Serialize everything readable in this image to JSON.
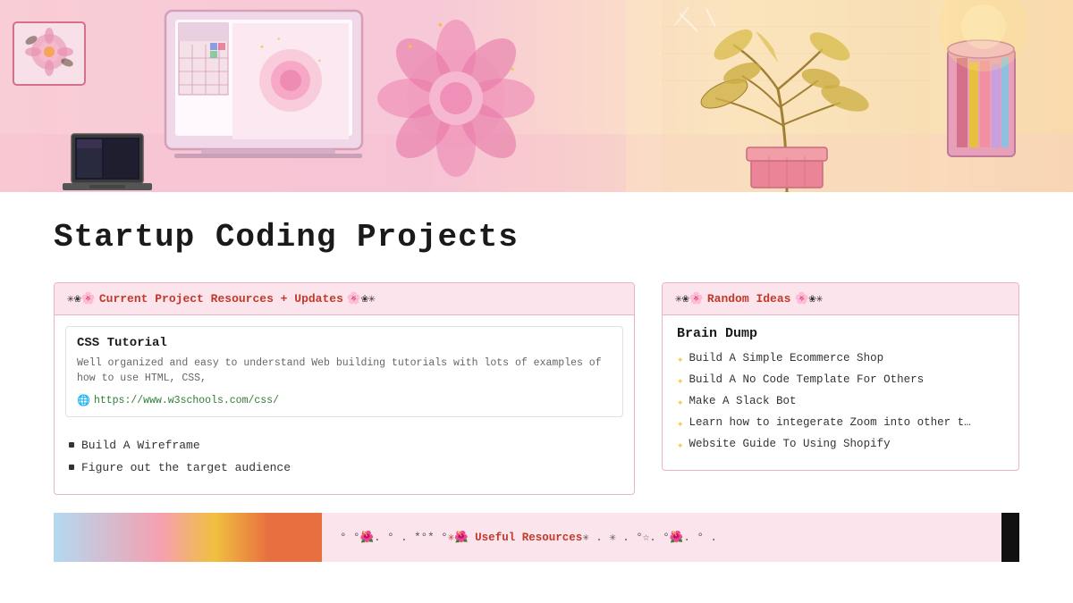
{
  "page": {
    "title": "Startup Coding Projects"
  },
  "hero": {
    "alt": "Illustrated desk scene with laptop, flowers, and plants"
  },
  "left_section": {
    "header": {
      "prefix": "✳❀🌸 ",
      "title": "Current Project Resources + Updates",
      "suffix": " 🌸❀✳"
    },
    "link_card": {
      "title": "CSS Tutorial",
      "description": "Well organized and easy to understand Web building tutorials with lots of examples of how to use HTML, CSS,",
      "url": "https://www.w3schools.com/css/"
    },
    "bullets": [
      "Build A Wireframe",
      "Figure out the target audience"
    ]
  },
  "right_section": {
    "header": {
      "prefix": "✳❀🌸 ",
      "title": "Random Ideas",
      "suffix": " 🌸❀✳"
    },
    "brain_dump_title": "Brain Dump",
    "ideas": [
      "Build A Simple Ecommerce Shop",
      "Build A No Code Template For Others",
      "Make A Slack Bot",
      "Learn how to integerate Zoom into other t…",
      "Website Guide To Using Shopify"
    ]
  },
  "bottom_bar": {
    "text": "° °🌺. ° . *°* ° ✳🌺 Useful Resources ✳ . ✳ . °☆. °🌺. ° ."
  },
  "icons": {
    "bullet": "▪",
    "idea_star": "✦",
    "url_icon": "🌐"
  }
}
